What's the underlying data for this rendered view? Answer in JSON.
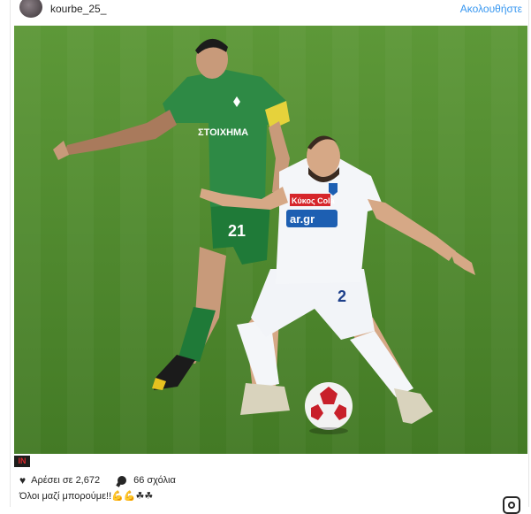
{
  "header": {
    "username": "kourbe_25_",
    "follow_label": "Ακολουθήστε"
  },
  "photo": {
    "green_jersey_number": "21",
    "green_sponsor": "ΣΤΟΙΧΗΜΑ",
    "white_jersey_number": "2",
    "white_sponsor_top": "Κύκος Cola",
    "white_sponsor_bottom": "ar.gr",
    "credit_logo": "IN"
  },
  "stats": {
    "likes": "Αρέσει σε 2,672",
    "comments": "66 σχόλια"
  },
  "caption": {
    "text": "Όλοι μαζί μπορούμε!!",
    "emojis": "💪💪☘☘"
  },
  "colors": {
    "link": "#3897f0",
    "pitch": "#4f8a2e",
    "green_kit": "#2e8a45",
    "white_kit": "#f4f6f9"
  },
  "icons": {
    "likes": "heart-icon",
    "comments": "comment-icon",
    "corner": "instagram-icon"
  }
}
